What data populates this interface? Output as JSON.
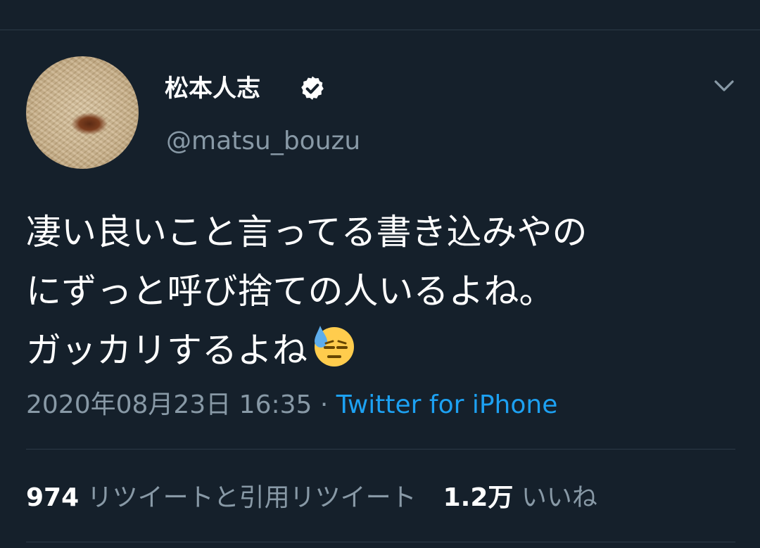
{
  "tweet": {
    "author": {
      "display_name": "松本人志",
      "handle": "@matsu_bouzu",
      "verified": true
    },
    "text_lines": [
      "凄い良いこと言ってる書き込みやの",
      "にずっと呼び捨ての人いるよね。",
      "ガッカリするよね"
    ],
    "emoji": "downcast-face-with-sweat",
    "timestamp": "2020年08月23日 16:35",
    "separator": "·",
    "source": "Twitter for iPhone",
    "stats": {
      "retweets_count": "974",
      "retweets_label": "リツイートと引用リツイート",
      "likes_count": "1.2万",
      "likes_label": "いいね"
    }
  },
  "colors": {
    "background": "#15202b",
    "primary_text": "#ffffff",
    "secondary_text": "#8899a6",
    "accent": "#1da1f2",
    "divider": "#2c3a47"
  },
  "icons": {
    "verified": "verified-badge-icon",
    "menu": "chevron-down-icon"
  }
}
